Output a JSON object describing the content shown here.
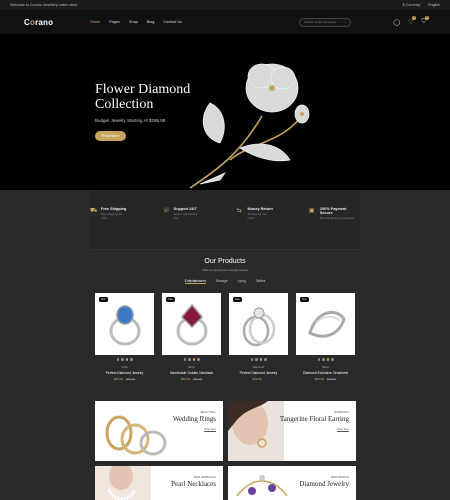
{
  "topbar": {
    "welcome": "Welcome to Corano Jewellery online store",
    "currency": "$ Currency",
    "language": "English"
  },
  "header": {
    "logo_pre": "C",
    "logo_o": "o",
    "logo_post": "rano",
    "nav": [
      "Home",
      "Pages",
      "Shop",
      "Blog",
      "Contact Us"
    ],
    "search_placeholder": "Search entire store here"
  },
  "hero": {
    "title": "Flower Diamond Collection",
    "subtitle": "Budget Jewelry Starting At $295.99",
    "button": "Read More"
  },
  "features": [
    {
      "title": "Free Shipping",
      "sub": "Free shipping all order",
      "icon": "truck-icon"
    },
    {
      "title": "Support 24/7",
      "sub": "Support 24 hours a day",
      "icon": "support-icon"
    },
    {
      "title": "Money Return",
      "sub": "30 days for free return",
      "icon": "money-icon"
    },
    {
      "title": "100% Payment Secure",
      "sub": "We ensure secure payment",
      "icon": "secure-icon"
    }
  ],
  "products": {
    "title": "Our Products",
    "subtitle": "Add our products to weekly lineup",
    "tabs": [
      "Entertainment",
      "Storage",
      "Lying",
      "Tables"
    ],
    "items": [
      {
        "tag": "New",
        "category": "Gold",
        "name": "Perfect Diamond Jewelry",
        "price": "$60.00",
        "old_price": "$70.00",
        "stone": "#3b78c8"
      },
      {
        "tag": "New",
        "category": "Mony",
        "name": "Handmade Golden Necklace",
        "price": "$50.00",
        "old_price": "$80.00",
        "stone": "#8a1a3a"
      },
      {
        "tag": "New",
        "category": "Diamond",
        "name": "Perfect Diamond Jewelry",
        "price": "$99.00",
        "old_price": "",
        "stone": "#d8d8d8"
      },
      {
        "tag": "New",
        "category": "Silver",
        "name": "Diamond Exclusive Ornament",
        "price": "$55.00",
        "old_price": "$75.00",
        "stone": "#d8d8d8"
      }
    ]
  },
  "banners": [
    {
      "label": "BEAUTIFUL",
      "title": "Wedding Rings",
      "link": "Shop Now"
    },
    {
      "label": "EARRINGS",
      "title": "Tangerine Floral Earring",
      "link": "Shop Now"
    },
    {
      "label": "NEW ARRIVALLS",
      "title": "Pearl Necklaces",
      "link": ""
    },
    {
      "label": "NEW DESIGN",
      "title": "Diamond Jewelry",
      "link": ""
    }
  ],
  "colors": {
    "accent": "#c9a45c",
    "background": "#2a2a2a",
    "hero": "#000000"
  }
}
